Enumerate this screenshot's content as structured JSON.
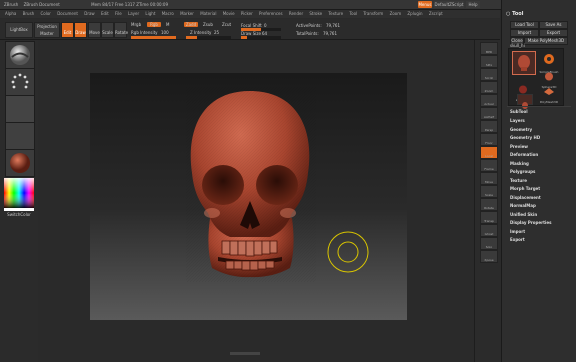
{
  "window": {
    "title_left": "ZBrush",
    "title_mid": "ZBrush Document",
    "title_stats": "Mem 84/17  Free 1317  ZTime 00:00:09"
  },
  "menu": [
    "Alpha",
    "Brush",
    "Color",
    "Document",
    "Draw",
    "Edit",
    "File",
    "Layer",
    "Light",
    "Macro",
    "Marker",
    "Material",
    "Movie",
    "Picker",
    "Preferences",
    "Render",
    "Stroke",
    "Texture",
    "Tool",
    "Transform",
    "Zoom",
    "Zplugin",
    "Zscript"
  ],
  "top_right": {
    "menus_btn": "Menus",
    "default_script": "DefaultZScript",
    "help": "Help"
  },
  "toolbar": {
    "lightbox": "LightBox",
    "projection_master": "Projection Master",
    "edit": "Edit",
    "draw": "Draw",
    "move": "Move",
    "scale": "Scale",
    "rotate": "Rotate",
    "mrgb": "Mrgb",
    "rgb": "Rgb",
    "m": "M",
    "zadd": "Zadd",
    "zsub": "Zsub",
    "zcut": "Zcut",
    "rgb_intensity_label": "Rgb Intensity",
    "rgb_intensity_value": "100",
    "z_intensity_label": "Z Intensity",
    "z_intensity_value": "25",
    "focal_shift_label": "Focal Shift",
    "focal_shift_value": "0",
    "draw_size_label": "Draw Size",
    "draw_size_value": "64",
    "active_points_label": "ActivePoints:",
    "active_points_value": "79,761",
    "total_points_label": "TotalPoints:",
    "total_points_value": "79,761"
  },
  "tool_palette": {
    "header": "Tool",
    "load_tool": "Load Tool",
    "save_as": "Save As",
    "import": "Import",
    "export": "Export",
    "clone": "Clone",
    "make_polymesh": "Make PolyMesh3D",
    "current_tool": "skull_hi",
    "thumbs": [
      {
        "label": "SimpleBrush"
      },
      {
        "label": "Sphere3D"
      },
      {
        "label": "ZSpheres"
      },
      {
        "label": "PolyMesh3D"
      }
    ],
    "sections": [
      "SubTool",
      "Layers",
      "Geometry",
      "Geometry HD",
      "Preview",
      "Deformation",
      "Masking",
      "Polygroups",
      "Texture",
      "Morph Target",
      "Displacement",
      "NormalMap",
      "Unified Skin",
      "Display Properties",
      "Import",
      "Export"
    ]
  },
  "left_shelf": {
    "color_label": "SwitchColor"
  },
  "right_shelf": [
    "BPR",
    "SPix",
    "Scroll",
    "Zoom",
    "Actual",
    "AAHalf",
    "Persp",
    "Floor",
    "Local",
    "Frame",
    "Move",
    "Scale",
    "Rotate",
    "Transp",
    "Ghost",
    "Solo",
    "Xpose"
  ],
  "colors": {
    "accent": "#e06a1f",
    "skull": "#b04a35",
    "brush_ring": "#d8c400"
  }
}
